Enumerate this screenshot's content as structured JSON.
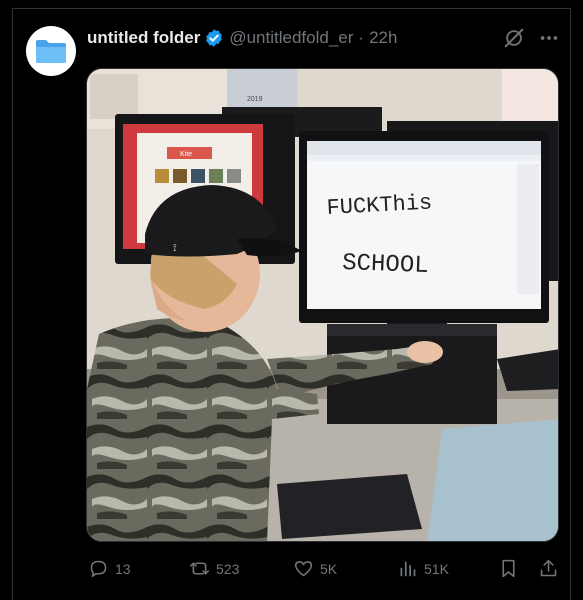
{
  "post": {
    "author_name": "untitled folder",
    "handle": "@untitledfold_er",
    "separator": "·",
    "time": "22h",
    "avatar_icon": "folder-icon",
    "verified_color": "#1d9bf0"
  },
  "media": {
    "screen_writing_line1": "FUCKThis",
    "screen_writing_line2": "SCHOOL",
    "left_screen_title": "Kite",
    "poster_label": "2019"
  },
  "actions": {
    "replies": "13",
    "reposts": "523",
    "likes": "5K",
    "views": "51K"
  },
  "colors": {
    "background": "#000000",
    "text_primary": "#e7e9ea",
    "text_secondary": "#71767b",
    "border": "#2f3336"
  }
}
